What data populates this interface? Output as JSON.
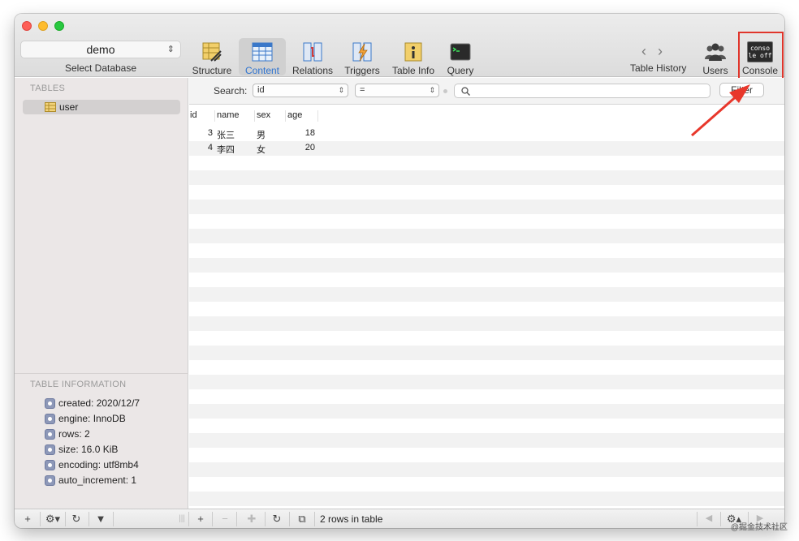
{
  "toolbar": {
    "database": "demo",
    "database_caption": "Select Database",
    "buttons": [
      {
        "label": "Structure"
      },
      {
        "label": "Content"
      },
      {
        "label": "Relations"
      },
      {
        "label": "Triggers"
      },
      {
        "label": "Table Info"
      },
      {
        "label": "Query"
      }
    ],
    "history_caption": "Table History",
    "users_label": "Users",
    "console_label": "Console",
    "console_icon_text_1": "conso",
    "console_icon_text_2": "le off"
  },
  "sidebar": {
    "tables_header": "TABLES",
    "tables": [
      {
        "name": "user"
      }
    ],
    "info_header": "TABLE INFORMATION",
    "info": [
      "created: 2020/12/7",
      "engine: InnoDB",
      "rows: 2",
      "size: 16.0 KiB",
      "encoding: utf8mb4",
      "auto_increment: 1"
    ]
  },
  "filter": {
    "search_label": "Search:",
    "field": "id",
    "operator": "=",
    "query": "",
    "filter_button": "Filter"
  },
  "grid": {
    "columns": [
      "id",
      "name",
      "sex",
      "age"
    ],
    "rows": [
      {
        "id": "3",
        "name": "张三",
        "sex": "男",
        "age": "18"
      },
      {
        "id": "4",
        "name": "李四",
        "sex": "女",
        "age": "20"
      }
    ]
  },
  "status": {
    "row_count": "2 rows in table"
  },
  "watermark": "@掘金技术社区",
  "colors": {
    "accent": "#2f74d0",
    "highlight": "#e0352b"
  }
}
